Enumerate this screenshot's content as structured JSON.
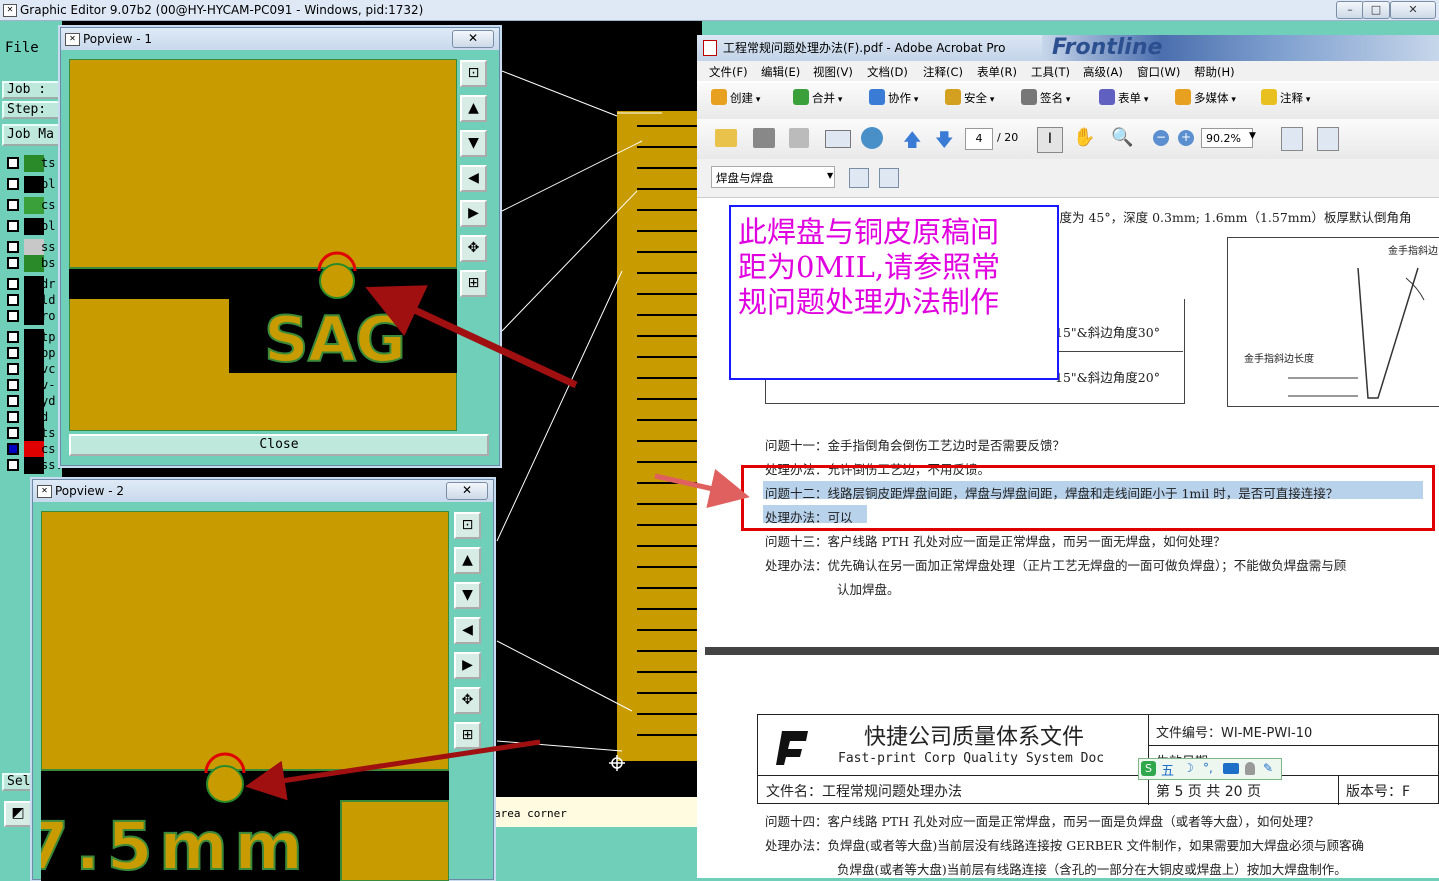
{
  "app": {
    "title": "Graphic Editor 9.07b2 (00@HY-HYCAM-PC091 - Windows, pid:1732)",
    "window_controls": [
      "–",
      "□",
      "✕"
    ]
  },
  "left_panel": {
    "file_menu": "File",
    "job_label": "Job :",
    "step_label": "Step:",
    "job_matrix_label": "Job Ma",
    "layers": [
      {
        "name": "ts",
        "color": "#2a8a2a"
      },
      {
        "name": "pl",
        "color": "#000000"
      },
      {
        "name": "cs",
        "color": "#3aa03a"
      },
      {
        "name": "pl",
        "color": "#000000"
      },
      {
        "name": "ss",
        "color": "#c8c8c8"
      },
      {
        "name": "bs",
        "color": "#2a8a2a"
      },
      {
        "name": "dr",
        "color": "#000000"
      },
      {
        "name": "ld",
        "color": "#000000"
      },
      {
        "name": "ro",
        "color": "#000000"
      },
      {
        "name": "tp",
        "color": "#000000"
      },
      {
        "name": "bp",
        "color": "#000000"
      },
      {
        "name": "vc",
        "color": "#000000"
      },
      {
        "name": "v-",
        "color": "#000000"
      },
      {
        "name": "yd",
        "color": "#000000"
      },
      {
        "name": "d",
        "color": "#000000"
      },
      {
        "name": "ts",
        "color": "#000000"
      },
      {
        "name": "cs",
        "color": "#e00000"
      },
      {
        "name": "ss.",
        "color": "#000000"
      }
    ],
    "sel_label": "Sel"
  },
  "canvas": {
    "status_text": "area corner"
  },
  "popview1": {
    "title": "Popview - 1",
    "close_icon": "✕",
    "pad_text": "SAG",
    "close_button": "Close"
  },
  "popview2": {
    "title": "Popview - 2",
    "close_icon": "✕",
    "pad_text": "7.5mm"
  },
  "acrobat": {
    "title": "工程常规问题处理办法(F).pdf - Adobe Acrobat Pro",
    "menus": [
      "文件(F)",
      "编辑(E)",
      "视图(V)",
      "文档(D)",
      "注释(C)",
      "表单(R)",
      "工具(T)",
      "高级(A)",
      "窗口(W)",
      "帮助(H)"
    ],
    "toolbar1": [
      "创建",
      "合并",
      "协作",
      "安全",
      "签名",
      "表单",
      "多媒体",
      "注释"
    ],
    "page_current": "4",
    "page_total": "/ 20",
    "zoom": "90.2%",
    "bookmark_select": "焊盘与焊盘",
    "doc": {
      "top_line": "角度为 45°，深度 0.3mm; 1.6mm（1.57mm）板厚默认倒角角",
      "table_cell1": "15\"&斜边角度30°",
      "table_cell2": "15\"&斜边角度20°",
      "fig_label1": "金手指斜边",
      "fig_label2": "金手指斜边长度",
      "q11": "问题十一：金手指倒角会倒伤工艺边时是否需要反馈？",
      "a11": "处理办法：允许倒伤工艺边，不用反馈。",
      "q12": "问题十二：线路层铜皮距焊盘间距，焊盘与焊盘间距，焊盘和走线间距小于 1mil 时，是否可直接连接？",
      "a12": "处理办法：可以",
      "q13": "问题十三：客户线路 PTH 孔处对应一面是正常焊盘，而另一面无焊盘，如何处理？",
      "a13a": "处理办法：优先确认在另一面加正常焊盘处理（正片工艺无焊盘的一面可做负焊盘）；不能做负焊盘需与顾",
      "a13b": "认加焊盘。",
      "header_title": "快捷公司质量体系文件",
      "header_subtitle": "Fast-print Corp Quality System Doc",
      "doc_no": "文件编号：WI-ME-PWI-10",
      "effective": "生效日期",
      "file_name": "文件名：工程常规问题处理办法",
      "page_info": "第 5 页 共 20 页",
      "version": "版本号：F",
      "q14": "问题十四：客户线路 PTH 孔处对应一面是正常焊盘，而另一面是负焊盘（或者等大盘），如何处理？",
      "a14a": "处理办法：负焊盘(或者等大盘)当前层没有线路连接按 GERBER 文件制作，如果需要加大焊盘必须与顾客确",
      "a14b": "负焊盘(或者等大盘)当前层有线路连接（含孔的一部分在大铜皮或焊盘上）按加大焊盘制作。"
    },
    "ime_bar": "五"
  },
  "annotation": {
    "line1": "此焊盘与铜皮原稿间",
    "line2": "距为0MIL,请参照常",
    "line3": "规问题处理办法制作"
  },
  "colors": {
    "copper": "#c89c00",
    "panel": "#6fcfb8",
    "annotation_text": "#e000e0",
    "annotation_border": "#1a1aff",
    "highlight_box": "#e00000",
    "arrow": "#a01010"
  }
}
